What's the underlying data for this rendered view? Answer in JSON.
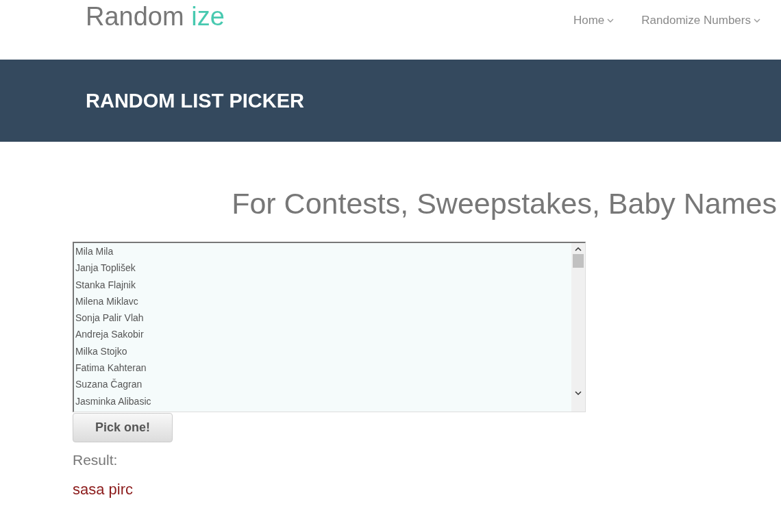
{
  "logo": {
    "main": "Random",
    "accent": "ize"
  },
  "nav": [
    {
      "label": "Home"
    },
    {
      "label": "Randomize Numbers"
    }
  ],
  "banner": {
    "title": "RANDOM LIST PICKER"
  },
  "heading": "For Contests, Sweepstakes, Baby Names",
  "list": [
    "Mila Mila",
    "Janja Toplišek",
    "Stanka Flajnik",
    "Milena Miklavc",
    "Sonja Palir Vlah",
    "Andreja Sakobir",
    "Milka Stojko",
    "Fatima Kahteran",
    "Suzana Čagran",
    "Jasminka Alibasic"
  ],
  "button": "Pick one!",
  "result_label": "Result:",
  "result": "sasa pirc"
}
